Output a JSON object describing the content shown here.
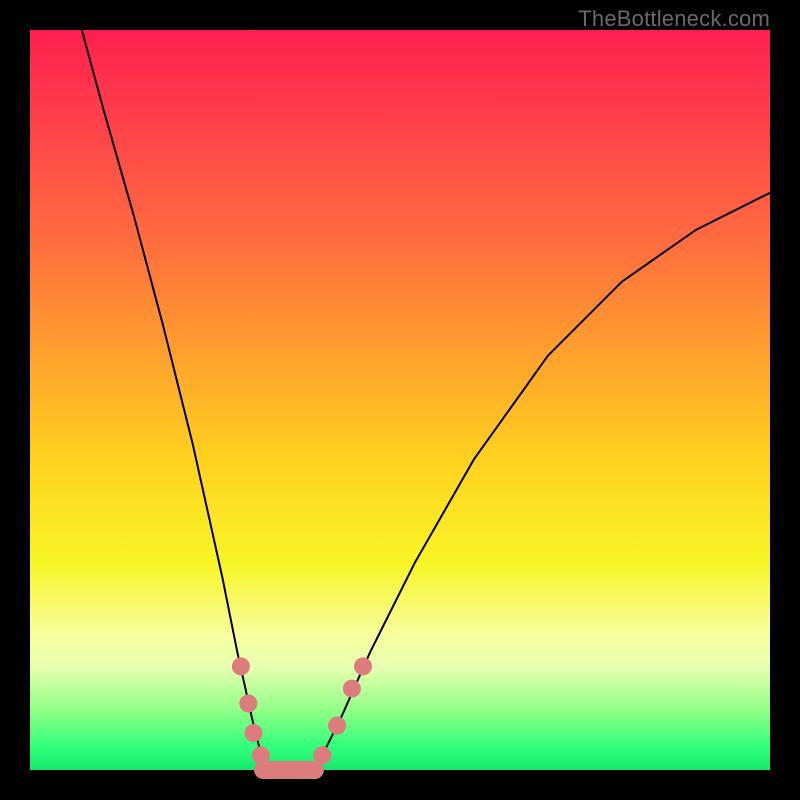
{
  "watermark": "TheBottleneck.com",
  "domain": "Chart",
  "chart_data": {
    "type": "line",
    "title": "",
    "xlabel": "",
    "ylabel": "",
    "xlim": [
      0,
      100
    ],
    "ylim": [
      0,
      100
    ],
    "grid": false,
    "legend": false,
    "background_gradient_stops": [
      {
        "pos": 0,
        "color": "#ff1f4f"
      },
      {
        "pos": 10,
        "color": "#ff3a4c"
      },
      {
        "pos": 28,
        "color": "#ff6b3f"
      },
      {
        "pos": 42,
        "color": "#ff9a2f"
      },
      {
        "pos": 58,
        "color": "#ffd11f"
      },
      {
        "pos": 72,
        "color": "#f7f526"
      },
      {
        "pos": 82,
        "color": "#f7ffa0"
      },
      {
        "pos": 86,
        "color": "#e8ffb0"
      },
      {
        "pos": 92,
        "color": "#8fff86"
      },
      {
        "pos": 97,
        "color": "#2fff7a"
      },
      {
        "pos": 100,
        "color": "#18e86a"
      }
    ],
    "series": [
      {
        "name": "bottleneck-curve",
        "x": [
          7,
          10,
          14,
          18,
          22,
          26,
          28,
          30,
          31,
          32,
          33,
          34,
          35,
          38,
          40,
          42,
          46,
          52,
          60,
          70,
          80,
          90,
          100
        ],
        "y": [
          100,
          89,
          75,
          60,
          44,
          26,
          16,
          7,
          3,
          1,
          0,
          0,
          0,
          0,
          3,
          7,
          16,
          28,
          42,
          56,
          66,
          73,
          78
        ]
      }
    ],
    "markers": [
      {
        "x": 28.5,
        "y": 14
      },
      {
        "x": 29.5,
        "y": 9
      },
      {
        "x": 30.2,
        "y": 5
      },
      {
        "x": 31.2,
        "y": 2
      },
      {
        "x": 33.0,
        "y": 0
      },
      {
        "x": 35.0,
        "y": 0
      },
      {
        "x": 37.0,
        "y": 0
      },
      {
        "x": 39.5,
        "y": 2
      },
      {
        "x": 41.5,
        "y": 6
      },
      {
        "x": 43.5,
        "y": 11
      },
      {
        "x": 45.0,
        "y": 14
      }
    ],
    "valley_floor": {
      "x_start": 31.5,
      "x_end": 38.5,
      "y": 0
    }
  }
}
